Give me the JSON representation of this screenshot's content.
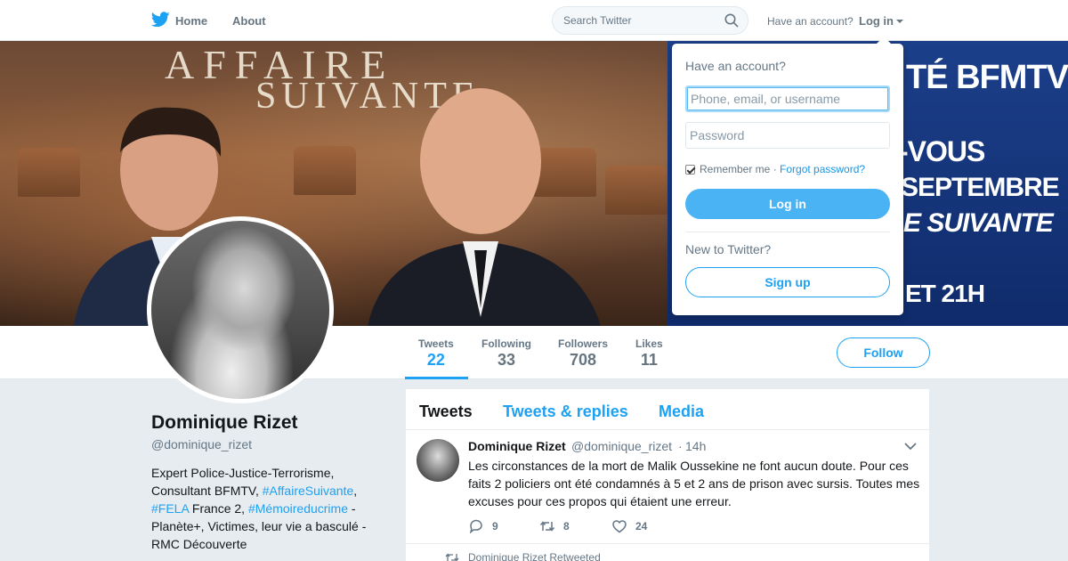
{
  "nav": {
    "logo_icon": "twitter-bird-icon",
    "home_label": "Home",
    "about_label": "About",
    "search_placeholder": "Search Twitter",
    "have_account": "Have an account?",
    "login_label": "Log in"
  },
  "banner": {
    "title_line1": "AFFAIRE",
    "title_line2": "SUIVANTE",
    "channel": "TÉ BFMTV",
    "promo_line1": "-VOUS",
    "promo_line2": "SEPTEMBRE",
    "promo_line3": "E SUIVANTE",
    "promo_line4": "ET 21H"
  },
  "profile_nav": {
    "stats": [
      {
        "label": "Tweets",
        "value": "22",
        "active": true
      },
      {
        "label": "Following",
        "value": "33"
      },
      {
        "label": "Followers",
        "value": "708"
      },
      {
        "label": "Likes",
        "value": "11"
      }
    ],
    "follow_label": "Follow"
  },
  "profile": {
    "name": "Dominique Rizet",
    "handle": "@dominique_rizet",
    "bio": {
      "part1": "Expert Police-Justice-Terrorisme, Consultant BFMTV, ",
      "hashtag1": "#AffaireSuivante",
      "part2": ", ",
      "hashtag2": "#FELA",
      "part3": " France 2, ",
      "hashtag3": "#Mémoireducrime",
      "part4": " - Planète+, Victimes, leur vie a basculé - RMC Découverte"
    }
  },
  "timeline": {
    "tabs": [
      {
        "label": "Tweets",
        "active": true
      },
      {
        "label": "Tweets & replies"
      },
      {
        "label": "Media"
      }
    ],
    "tweet": {
      "author": "Dominique Rizet",
      "handle": "@dominique_rizet",
      "separator": "·",
      "time": "14h",
      "text": "Les circonstances de la mort de Malik Oussekine ne font aucun doute. Pour ces faits 2 policiers ont été condamnés à 5 et 2 ans de prison avec sursis. Toutes mes excuses pour ces propos qui étaient une erreur.",
      "replies": "9",
      "retweets": "8",
      "likes": "24"
    },
    "retweeted_label": "Dominique Rizet Retweeted"
  },
  "login_dropdown": {
    "title": "Have an account?",
    "username_placeholder": "Phone, email, or username",
    "password_placeholder": "Password",
    "remember_label": "Remember me",
    "separator": " · ",
    "forgot_label": "Forgot password?",
    "login_button": "Log in",
    "new_label": "New to Twitter?",
    "signup_button": "Sign up"
  },
  "colors": {
    "accent": "#1da1f2",
    "login_button": "#4ab3f4",
    "page_bg": "#e6ecf0"
  }
}
